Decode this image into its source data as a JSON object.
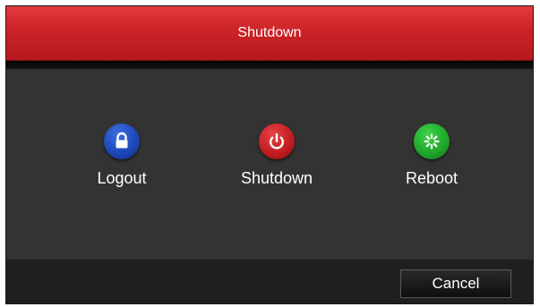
{
  "dialog": {
    "title": "Shutdown"
  },
  "actions": [
    {
      "label": "Logout",
      "icon": "lock-icon",
      "color": "#1c45b4"
    },
    {
      "label": "Shutdown",
      "icon": "power-icon",
      "color": "#c01c20"
    },
    {
      "label": "Reboot",
      "icon": "reboot-icon",
      "color": "#1ea52a"
    }
  ],
  "footer": {
    "cancel_label": "Cancel"
  },
  "colors": {
    "titlebar": "#cc2327",
    "body": "#333333",
    "footer": "#1f1f1f"
  }
}
